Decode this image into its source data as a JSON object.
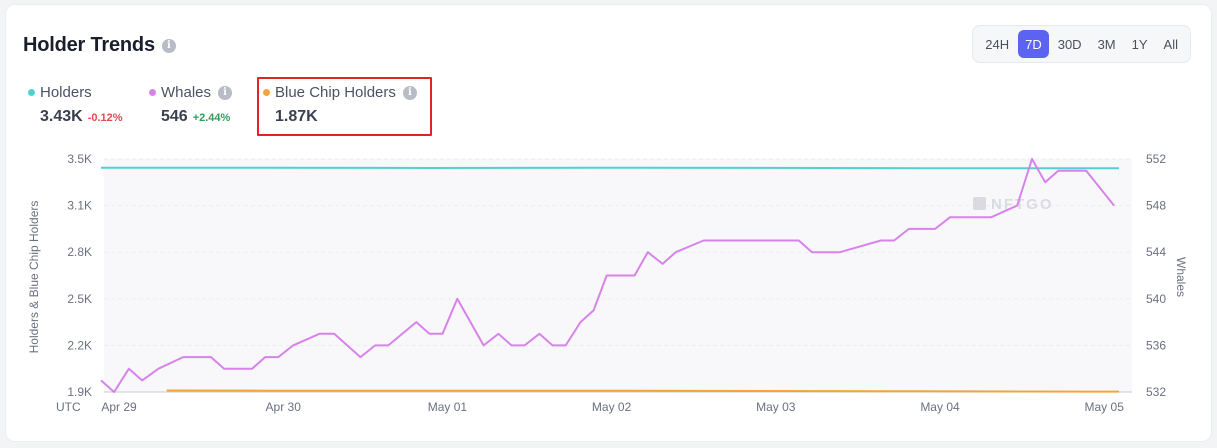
{
  "header": {
    "title": "Holder Trends"
  },
  "time_ranges": [
    {
      "label": "24H",
      "active": false
    },
    {
      "label": "7D",
      "active": true
    },
    {
      "label": "30D",
      "active": false
    },
    {
      "label": "3M",
      "active": false
    },
    {
      "label": "1Y",
      "active": false
    },
    {
      "label": "All",
      "active": false
    }
  ],
  "legend": {
    "holders": {
      "label": "Holders",
      "value": "3.43K",
      "change": "-0.12%",
      "color": "#4fd1d1"
    },
    "whales": {
      "label": "Whales",
      "value": "546",
      "change": "+2.44%",
      "color": "#d783ea"
    },
    "bluechip": {
      "label": "Blue Chip Holders",
      "value": "1.87K",
      "color": "#f2a53a"
    }
  },
  "watermark": "NFTGO",
  "chart_data": {
    "type": "line",
    "xlabel": "",
    "ylabel_left": "Holders & Blue Chip Holders",
    "ylabel_right": "Whales",
    "x_prefix": "UTC",
    "x_ticks": [
      "Apr 29",
      "Apr 30",
      "May 01",
      "May 02",
      "May 03",
      "May 04",
      "May 05"
    ],
    "y_left_ticks": [
      "1.9K",
      "2.2K",
      "2.5K",
      "2.8K",
      "3.1K",
      "3.5K"
    ],
    "y_left_range": [
      1900,
      3500
    ],
    "y_right_ticks": [
      "532",
      "536",
      "540",
      "544",
      "548",
      "552"
    ],
    "y_right_range": [
      532,
      552
    ],
    "x_range": [
      0,
      6.2
    ],
    "grid": true,
    "series": [
      {
        "name": "Holders",
        "axis": "left",
        "color": "#4fd1d1",
        "x": [
          0,
          1,
          2,
          3,
          4,
          5,
          6,
          6.2
        ],
        "y": [
          3440,
          3440,
          3438,
          3440,
          3439,
          3437,
          3436,
          3436
        ]
      },
      {
        "name": "Blue Chip Holders",
        "axis": "left",
        "color": "#f2a53a",
        "x": [
          0.4,
          1,
          2,
          3,
          4,
          5,
          6,
          6.2
        ],
        "y": [
          1910,
          1909,
          1909,
          1909,
          1907,
          1905,
          1903,
          1903
        ]
      },
      {
        "name": "Whales",
        "axis": "right",
        "color": "#d783ea",
        "x": [
          0,
          0.08,
          0.17,
          0.25,
          0.35,
          0.5,
          0.67,
          0.75,
          0.92,
          1.0,
          1.08,
          1.17,
          1.33,
          1.42,
          1.58,
          1.67,
          1.75,
          1.92,
          2.0,
          2.08,
          2.17,
          2.33,
          2.42,
          2.5,
          2.58,
          2.67,
          2.75,
          2.83,
          2.92,
          3.0,
          3.08,
          3.25,
          3.33,
          3.42,
          3.5,
          3.67,
          3.83,
          4.0,
          4.08,
          4.25,
          4.33,
          4.42,
          4.5,
          4.75,
          4.83,
          4.92,
          5.0,
          5.08,
          5.17,
          5.25,
          5.33,
          5.42,
          5.58,
          5.67,
          5.75,
          5.83,
          6.0,
          6.17
        ],
        "y": [
          533,
          532,
          534,
          533,
          534,
          535,
          535,
          534,
          534,
          535,
          535,
          536,
          537,
          537,
          535,
          536,
          536,
          538,
          537,
          537,
          540,
          536,
          537,
          536,
          536,
          537,
          536,
          536,
          538,
          539,
          542,
          542,
          544,
          543,
          544,
          545,
          545,
          545,
          545,
          545,
          544,
          544,
          544,
          545,
          545,
          546,
          546,
          546,
          547,
          547,
          547,
          547,
          548,
          552,
          550,
          551,
          551,
          548
        ]
      }
    ]
  }
}
